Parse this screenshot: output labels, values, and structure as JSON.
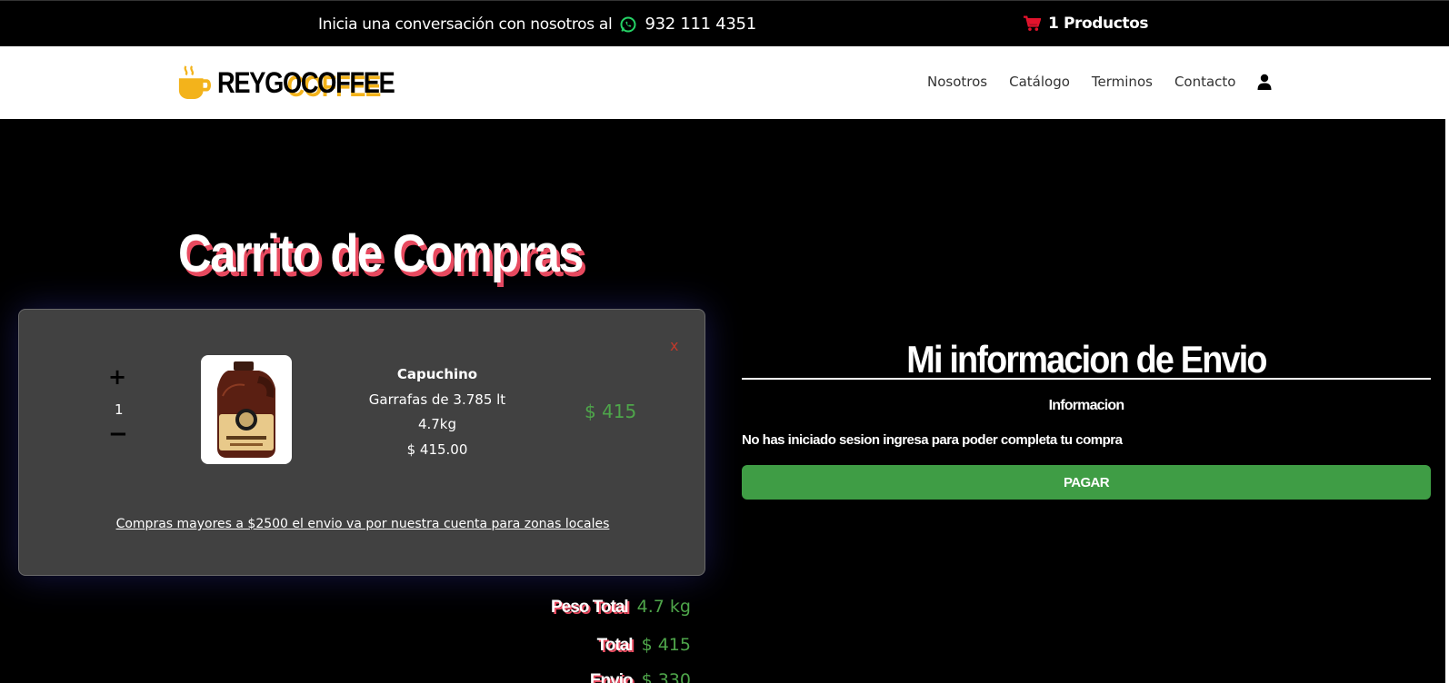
{
  "topbar": {
    "message": "Inicia una conversación con nosotros al",
    "phone": "932 111 4351",
    "cart_label": "1 Productos",
    "whatsapp_color": "#25d366",
    "cart_icon_color": "#e3132d"
  },
  "brand": {
    "name_main": "REYGO",
    "name_accent": "COFFEE",
    "accent_color": "#f3b31b"
  },
  "nav": {
    "items": [
      "Nosotros",
      "Catálogo",
      "Terminos",
      "Contacto"
    ]
  },
  "page": {
    "title": "Carrito de Compras"
  },
  "cart": {
    "items": [
      {
        "quantity": "1",
        "plus": "+",
        "minus": "−",
        "name": "Capuchino",
        "presentation": "Garrafas de 3.785 lt",
        "weight": "4.7kg",
        "unit_price": "$ 415.00",
        "line_total": "$ 415",
        "remove": "x"
      }
    ],
    "promo": "Compras mayores a $2500 el envio va por nuestra cuenta para zonas locales"
  },
  "totals": {
    "weight_label": "Peso Total",
    "weight_value": "4.7 kg",
    "total_label": "Total",
    "total_value": "$ 415",
    "shipping_label": "Envio",
    "shipping_value": "$ 330"
  },
  "shipping": {
    "title": "Mi informacion de Envio",
    "section_label": "Informacion",
    "login_message": "No has iniciado sesion ingresa para poder completa tu compra",
    "pay_button": "PAGAR",
    "pay_color": "#3f9d45"
  }
}
